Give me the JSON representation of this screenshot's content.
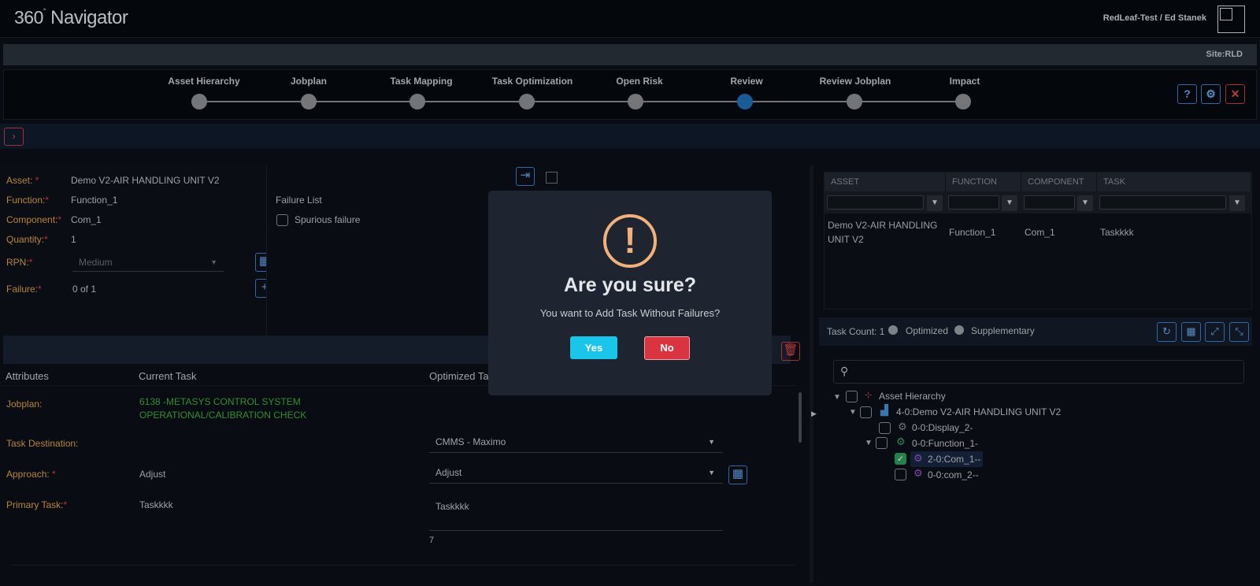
{
  "app": {
    "logo_num": "360",
    "logo_text": "Navigator",
    "user": "RedLeaf-Test / Ed Stanek",
    "site": "Site:RLD"
  },
  "steps": [
    "Asset Hierarchy",
    "Jobplan",
    "Task Mapping",
    "Task Optimization",
    "Open Risk",
    "Review",
    "Review Jobplan",
    "Impact"
  ],
  "active_step": "Review",
  "header_buttons": {
    "help": "?",
    "close": "✕"
  },
  "form": {
    "asset_label": "Asset:",
    "asset_value": "Demo V2-AIR HANDLING UNIT V2",
    "function_label": "Function:",
    "function_value": "Function_1",
    "component_label": "Component:",
    "component_value": "Com_1",
    "quantity_label": "Quantity:",
    "quantity_value": "1",
    "rpn_label": "RPN:",
    "rpn_value": "Medium",
    "failure_label": "Failure:",
    "failure_value": "0 of 1",
    "required_mark": "*"
  },
  "failure_list": {
    "title": "Failure List",
    "items": [
      "Spurious failure"
    ]
  },
  "task_table": {
    "headers": [
      "Attributes",
      "Current Task",
      "Optimized Ta"
    ],
    "jobplan_label": "Jobplan:",
    "jobplan_current": "6138 -METASYS CONTROL SYSTEM OPERATIONAL/CALIBRATION CHECK",
    "destination_label": "Task Destination:",
    "destination_optimized": "CMMS - Maximo",
    "approach_label": "Approach:",
    "approach_current": "Adjust",
    "approach_optimized": "Adjust",
    "primary_label": "Primary Task:",
    "primary_current": "Taskkkk",
    "primary_optimized": "Taskkkk",
    "char_count": "7"
  },
  "grid": {
    "headers": [
      "ASSET",
      "FUNCTION",
      "COMPONENT",
      "TASK"
    ],
    "row": [
      "Demo V2-AIR HANDLING UNIT V2",
      "Function_1",
      "Com_1",
      "Taskkkk"
    ]
  },
  "tree": {
    "task_count_label": "Task Count:",
    "task_count": "1",
    "radio_optimized": "Optimized",
    "radio_supplementary": "Supplementary",
    "nodes": [
      "Asset Hierarchy",
      "4-0:Demo V2-AIR HANDLING UNIT V2",
      "0-0:Display_2-",
      "0-0:Function_1-",
      "2-0:Com_1--",
      "0-0:com_2--"
    ]
  },
  "dialog": {
    "icon": "!",
    "title": "Are you sure?",
    "message": "You want to Add Task Without Failures?",
    "yes": "Yes",
    "no": "No"
  }
}
